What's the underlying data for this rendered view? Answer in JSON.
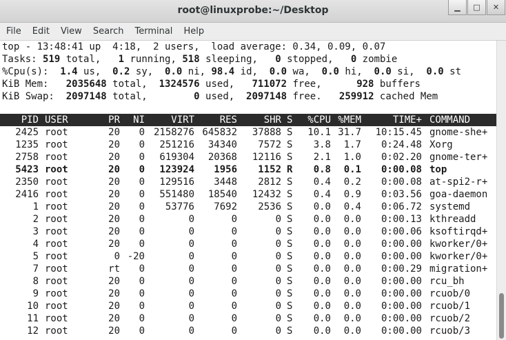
{
  "window": {
    "title": "root@linuxprobe:~/Desktop",
    "minimize_glyph": "▁",
    "maximize_glyph": "□",
    "close_glyph": "✕"
  },
  "menu": [
    "File",
    "Edit",
    "View",
    "Search",
    "Terminal",
    "Help"
  ],
  "summary": {
    "line1": "top - 13:48:41 up  4:18,  2 users,  load average: 0.34, 0.09, 0.07",
    "tasks": [
      "Tasks: ",
      "519",
      " total,   ",
      "1",
      " running, ",
      "518",
      " sleeping,   ",
      "0",
      " stopped,   ",
      "0",
      " zombie"
    ],
    "cpu": [
      "%Cpu(s):  ",
      "1.4",
      " us,  ",
      "0.2",
      " sy,  ",
      "0.0",
      " ni, ",
      "98.4",
      " id,  ",
      "0.0",
      " wa,  ",
      "0.0",
      " hi,  ",
      "0.0",
      " si,  ",
      "0.0",
      " st"
    ],
    "mem": [
      "KiB Mem:   ",
      "2035648",
      " total,  ",
      "1324576",
      " used,   ",
      "711072",
      " free,      ",
      "928",
      " buffers"
    ],
    "swap": [
      "KiB Swap:  ",
      "2097148",
      " total,        ",
      "0",
      " used,  ",
      "2097148",
      " free.   ",
      "259912",
      " cached Mem"
    ]
  },
  "columns": [
    "PID",
    "USER",
    "PR",
    "NI",
    "VIRT",
    "RES",
    "SHR",
    "S",
    "%CPU",
    "%MEM",
    "TIME+",
    "COMMAND"
  ],
  "processes": [
    [
      "2425",
      "root",
      "20",
      "0",
      "2158276",
      "645832",
      "37888",
      "S",
      "10.1",
      "31.7",
      "10:15.45",
      "gnome-she+"
    ],
    [
      "1235",
      "root",
      "20",
      "0",
      "251216",
      "34340",
      "7572",
      "S",
      "3.8",
      "1.7",
      "0:24.48",
      "Xorg"
    ],
    [
      "2758",
      "root",
      "20",
      "0",
      "619304",
      "20368",
      "12116",
      "S",
      "2.1",
      "1.0",
      "0:02.20",
      "gnome-ter+"
    ],
    [
      "5423",
      "root",
      "20",
      "0",
      "123924",
      "1956",
      "1152",
      "R",
      "0.8",
      "0.1",
      "0:00.08",
      "top"
    ],
    [
      "2350",
      "root",
      "20",
      "0",
      "129516",
      "3448",
      "2812",
      "S",
      "0.4",
      "0.2",
      "0:00.08",
      "at-spi2-r+"
    ],
    [
      "2416",
      "root",
      "20",
      "0",
      "551480",
      "18540",
      "12432",
      "S",
      "0.4",
      "0.9",
      "0:03.56",
      "goa-daemon"
    ],
    [
      "1",
      "root",
      "20",
      "0",
      "53776",
      "7692",
      "2536",
      "S",
      "0.0",
      "0.4",
      "0:06.72",
      "systemd"
    ],
    [
      "2",
      "root",
      "20",
      "0",
      "0",
      "0",
      "0",
      "S",
      "0.0",
      "0.0",
      "0:00.13",
      "kthreadd"
    ],
    [
      "3",
      "root",
      "20",
      "0",
      "0",
      "0",
      "0",
      "S",
      "0.0",
      "0.0",
      "0:00.06",
      "ksoftirqd+"
    ],
    [
      "4",
      "root",
      "20",
      "0",
      "0",
      "0",
      "0",
      "S",
      "0.0",
      "0.0",
      "0:00.00",
      "kworker/0+"
    ],
    [
      "5",
      "root",
      "0",
      "-20",
      "0",
      "0",
      "0",
      "S",
      "0.0",
      "0.0",
      "0:00.00",
      "kworker/0+"
    ],
    [
      "7",
      "root",
      "rt",
      "0",
      "0",
      "0",
      "0",
      "S",
      "0.0",
      "0.0",
      "0:00.29",
      "migration+"
    ],
    [
      "8",
      "root",
      "20",
      "0",
      "0",
      "0",
      "0",
      "S",
      "0.0",
      "0.0",
      "0:00.00",
      "rcu_bh"
    ],
    [
      "9",
      "root",
      "20",
      "0",
      "0",
      "0",
      "0",
      "S",
      "0.0",
      "0.0",
      "0:00.00",
      "rcuob/0"
    ],
    [
      "10",
      "root",
      "20",
      "0",
      "0",
      "0",
      "0",
      "S",
      "0.0",
      "0.0",
      "0:00.00",
      "rcuob/1"
    ],
    [
      "11",
      "root",
      "20",
      "0",
      "0",
      "0",
      "0",
      "S",
      "0.0",
      "0.0",
      "0:00.00",
      "rcuob/2"
    ],
    [
      "12",
      "root",
      "20",
      "0",
      "0",
      "0",
      "0",
      "S",
      "0.0",
      "0.0",
      "0:00.00",
      "rcuob/3"
    ]
  ],
  "highlighted_pid": "5423"
}
